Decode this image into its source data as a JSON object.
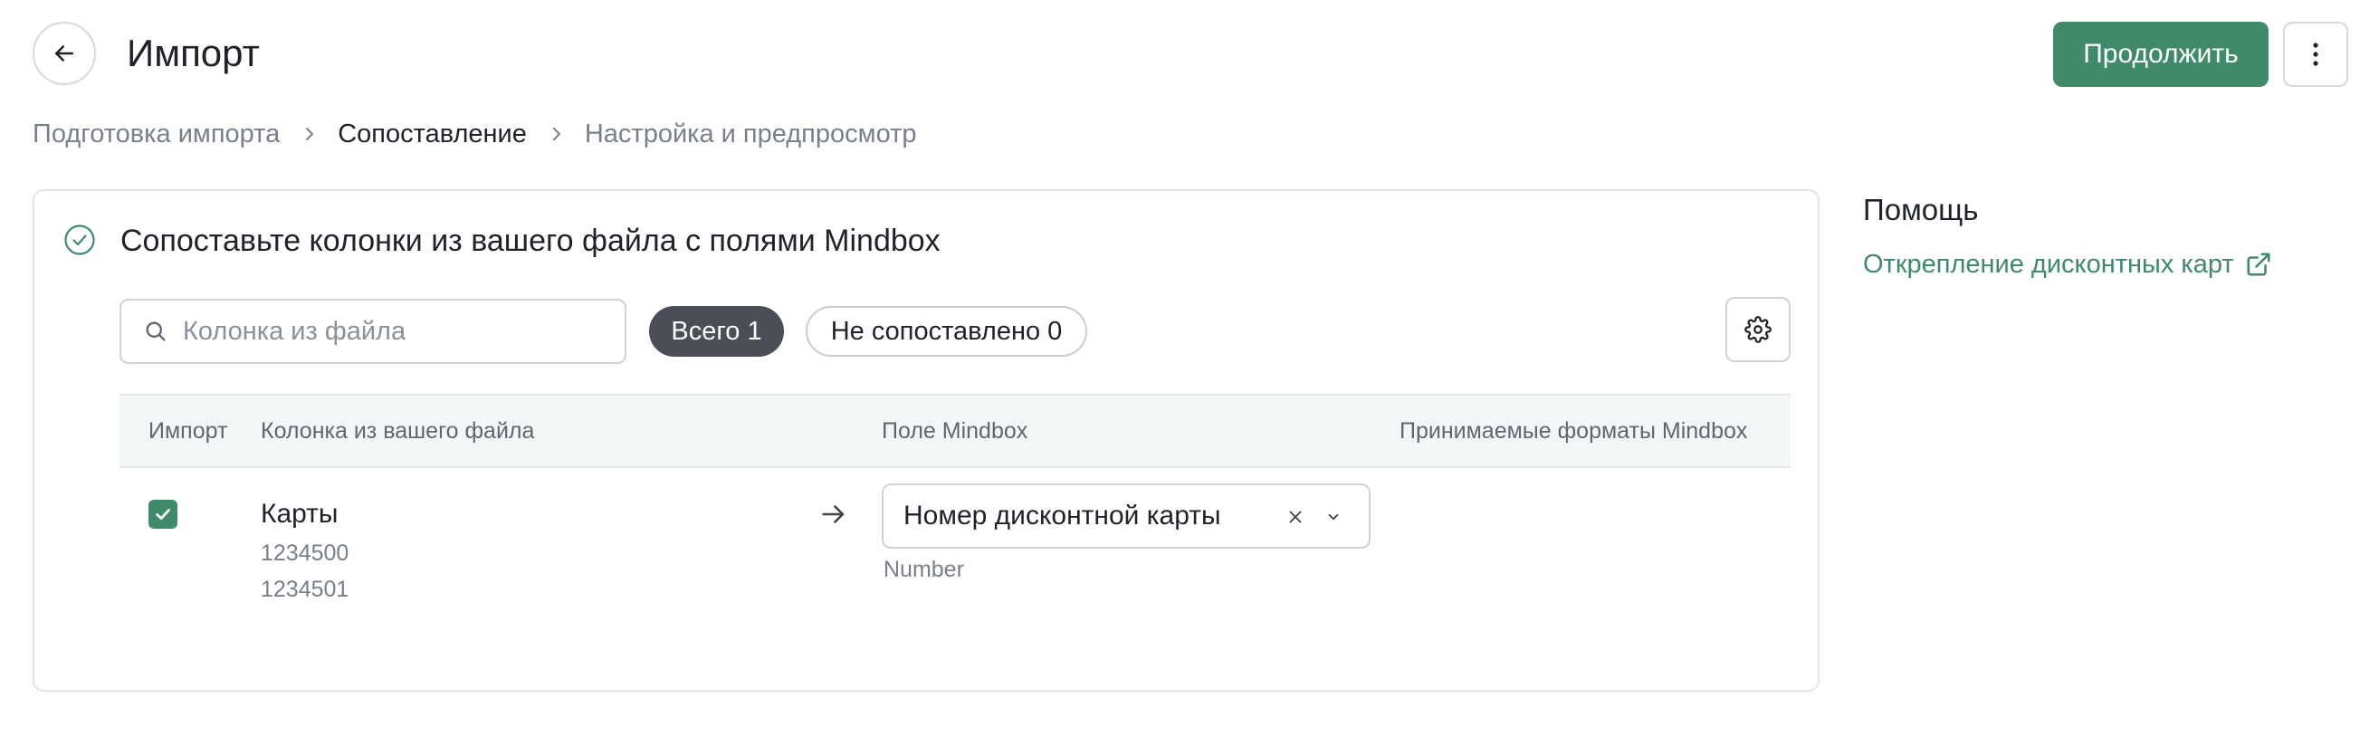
{
  "header": {
    "title": "Импорт",
    "continue_label": "Продолжить"
  },
  "breadcrumb": {
    "steps": [
      {
        "label": "Подготовка импорта",
        "active": false
      },
      {
        "label": "Сопоставление",
        "active": true
      },
      {
        "label": "Настройка и предпросмотр",
        "active": false
      }
    ]
  },
  "card": {
    "title": "Сопоставьте колонки из вашего файла с полями Mindbox",
    "search_placeholder": "Колонка из файла",
    "filters": {
      "all_label": "Всего 1",
      "unmatched_label": "Не сопоставлено 0"
    },
    "table": {
      "headers": [
        "Импорт",
        "Колонка из вашего файла",
        "Поле Mindbox",
        "Принимаемые форматы Mindbox"
      ],
      "rows": [
        {
          "import_checked": true,
          "column_name": "Карты",
          "samples": [
            "1234500",
            "1234501"
          ],
          "mindbox_field": "Номер дисконтной карты",
          "field_type": "Number",
          "formats": ""
        }
      ]
    }
  },
  "help": {
    "title": "Помощь",
    "link_label": "Открепление дисконтных карт"
  },
  "colors": {
    "accent": "#3e8a69",
    "chip_active_bg": "#4a4f57",
    "table_header_bg": "#f3f6f7",
    "muted_text": "#7a8089"
  },
  "icons": [
    "arrow-left-icon",
    "more-vertical-icon",
    "chevron-right-icon",
    "check-circle-icon",
    "search-icon",
    "gear-icon",
    "checkmark-icon",
    "arrow-right-icon",
    "close-icon",
    "chevron-down-icon",
    "external-link-icon"
  ]
}
